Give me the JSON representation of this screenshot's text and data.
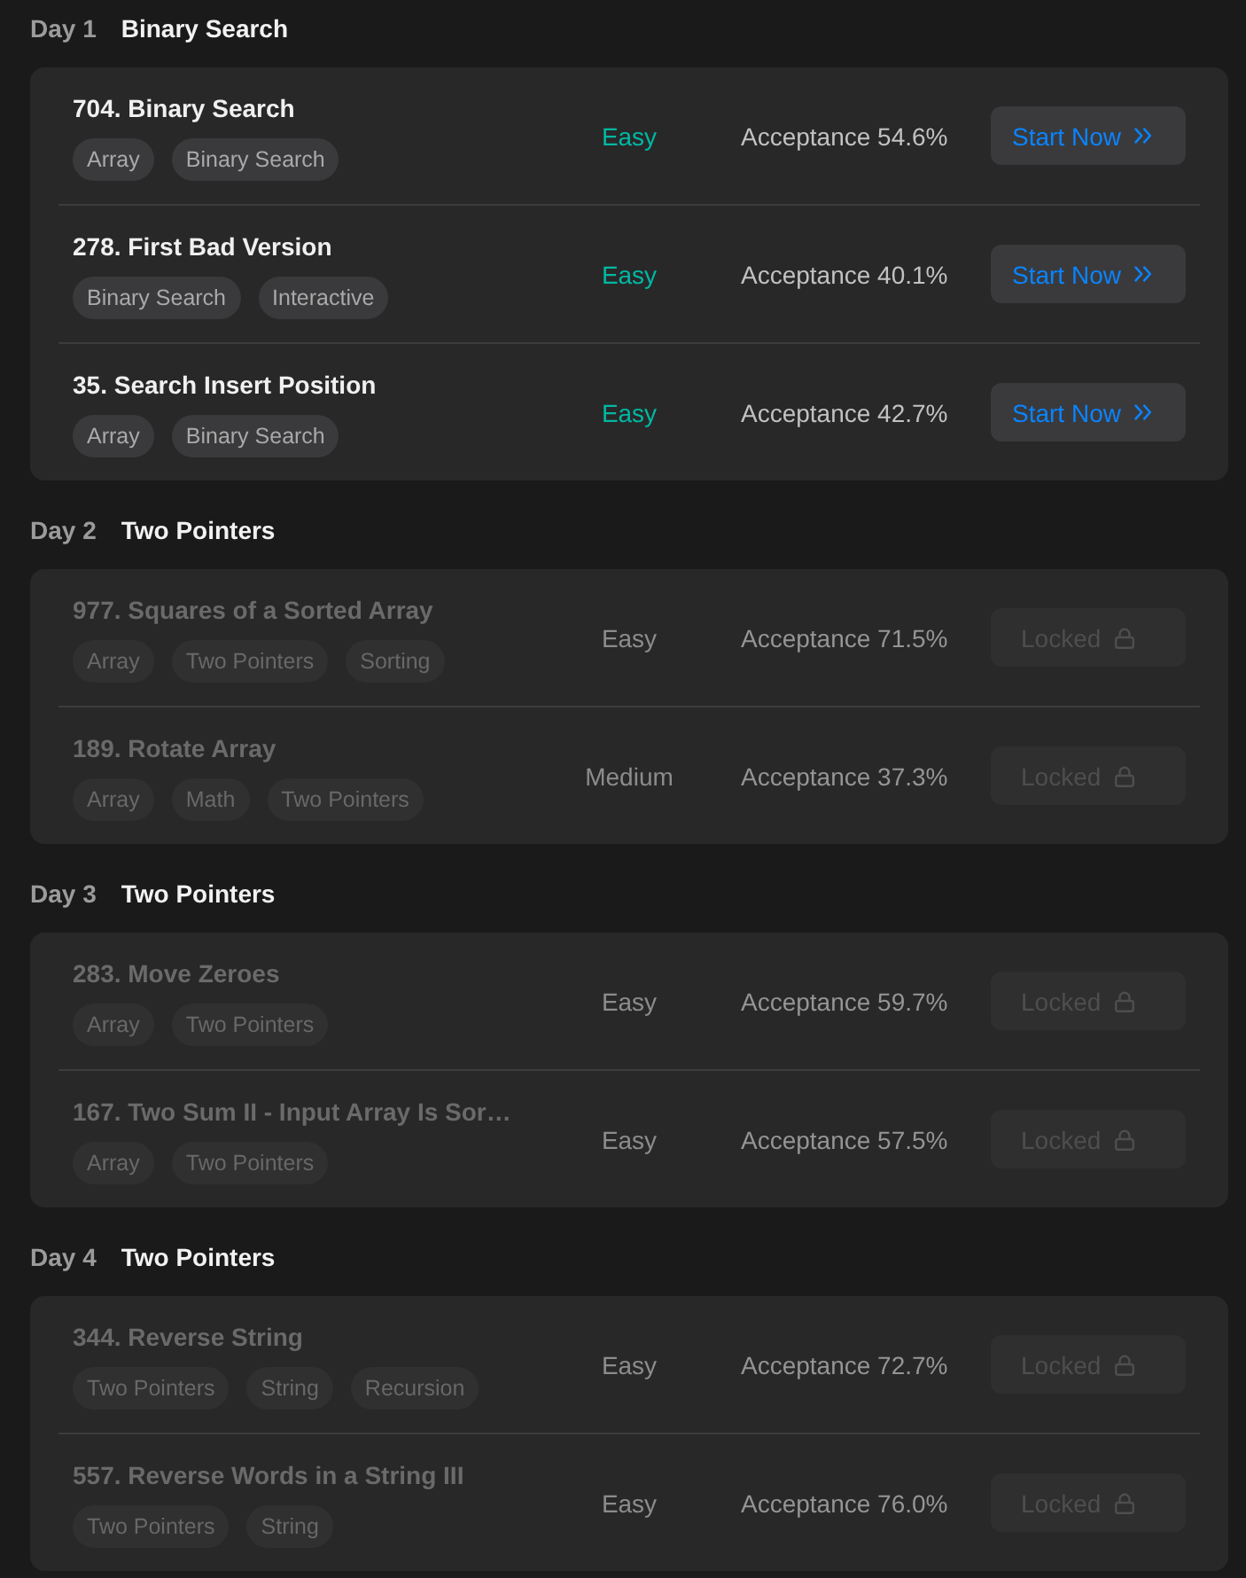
{
  "days": [
    {
      "label": "Day 1",
      "topic": "Binary Search",
      "problems": [
        {
          "title": "704. Binary Search",
          "tags": [
            "Array",
            "Binary Search"
          ],
          "difficulty": "Easy",
          "acceptance": "Acceptance 54.6%",
          "locked": false,
          "button": "Start Now"
        },
        {
          "title": "278. First Bad Version",
          "tags": [
            "Binary Search",
            "Interactive"
          ],
          "difficulty": "Easy",
          "acceptance": "Acceptance 40.1%",
          "locked": false,
          "button": "Start Now"
        },
        {
          "title": "35. Search Insert Position",
          "tags": [
            "Array",
            "Binary Search"
          ],
          "difficulty": "Easy",
          "acceptance": "Acceptance 42.7%",
          "locked": false,
          "button": "Start Now"
        }
      ]
    },
    {
      "label": "Day 2",
      "topic": "Two Pointers",
      "problems": [
        {
          "title": "977. Squares of a Sorted Array",
          "tags": [
            "Array",
            "Two Pointers",
            "Sorting"
          ],
          "difficulty": "Easy",
          "acceptance": "Acceptance 71.5%",
          "locked": true,
          "button": "Locked"
        },
        {
          "title": "189. Rotate Array",
          "tags": [
            "Array",
            "Math",
            "Two Pointers"
          ],
          "difficulty": "Medium",
          "acceptance": "Acceptance 37.3%",
          "locked": true,
          "button": "Locked"
        }
      ]
    },
    {
      "label": "Day 3",
      "topic": "Two Pointers",
      "problems": [
        {
          "title": "283. Move Zeroes",
          "tags": [
            "Array",
            "Two Pointers"
          ],
          "difficulty": "Easy",
          "acceptance": "Acceptance 59.7%",
          "locked": true,
          "button": "Locked"
        },
        {
          "title": "167. Two Sum II - Input Array Is Sor…",
          "tags": [
            "Array",
            "Two Pointers"
          ],
          "difficulty": "Easy",
          "acceptance": "Acceptance 57.5%",
          "locked": true,
          "button": "Locked"
        }
      ]
    },
    {
      "label": "Day 4",
      "topic": "Two Pointers",
      "problems": [
        {
          "title": "344. Reverse String",
          "tags": [
            "Two Pointers",
            "String",
            "Recursion"
          ],
          "difficulty": "Easy",
          "acceptance": "Acceptance 72.7%",
          "locked": true,
          "button": "Locked"
        },
        {
          "title": "557. Reverse Words in a String III",
          "tags": [
            "Two Pointers",
            "String"
          ],
          "difficulty": "Easy",
          "acceptance": "Acceptance 76.0%",
          "locked": true,
          "button": "Locked"
        }
      ]
    }
  ]
}
